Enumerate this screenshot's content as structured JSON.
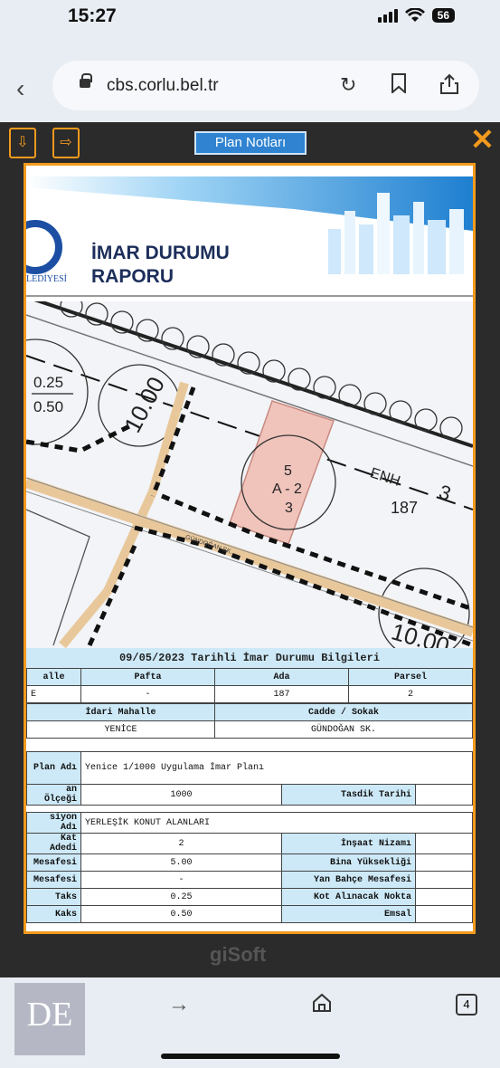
{
  "status": {
    "time": "15:27",
    "battery": "56"
  },
  "browser": {
    "url": "cbs.corlu.bel.tr"
  },
  "viewer": {
    "plan_button": "Plan Notları",
    "close": "✕",
    "footer_brand": "giSoft"
  },
  "report": {
    "logo_text": "LEDİYESİ",
    "title_line1": "İMAR DURUMU",
    "title_line2": "RAPORU"
  },
  "map": {
    "ratio_top": "0.25",
    "ratio_bottom": "0.50",
    "road_width_left": "10.00",
    "parcel_top": "5",
    "parcel_mid": "A - 2",
    "parcel_bottom": "3",
    "road_code": "ENH",
    "road_num": "3",
    "block_no": "187",
    "street_label": "GÜNDOĞAN SK.",
    "road_width_right": "10.00"
  },
  "info": {
    "title": "09/05/2023 Tarihli İmar Durumu Bilgileri",
    "head1": [
      "alle",
      "Pafta",
      "Ada",
      "Parsel"
    ],
    "row1": [
      "E",
      "-",
      "187",
      "2"
    ],
    "head2": [
      "İdari Mahalle",
      "Cadde / Sokak"
    ],
    "row2": [
      "YENİCE",
      "GÜNDOĞAN SK."
    ],
    "plan_label": "Plan Adı",
    "plan_value": "Yenice 1/1000 Uygulama İmar Planı",
    "scale_label": "an Ölçeği",
    "scale_value": "1000",
    "approval_label": "Tasdik Tarihi",
    "approval_value": "",
    "function_label": "siyon Adı",
    "function_value": "YERLEŞİK KONUT ALANLARI",
    "rows": [
      {
        "l": "Kat Adedi",
        "v": "2",
        "l2": "İnşaat Nizamı",
        "v2": ""
      },
      {
        "l": "Mesafesi",
        "v": "5.00",
        "l2": "Bina Yüksekliği",
        "v2": ""
      },
      {
        "l": "Mesafesi",
        "v": "-",
        "l2": "Yan Bahçe Mesafesi",
        "v2": ""
      },
      {
        "l": "Taks",
        "v": "0.25",
        "l2": "Kot Alınacak Nokta",
        "v2": ""
      },
      {
        "l": "Kaks",
        "v": "0.50",
        "l2": "Emsal",
        "v2": ""
      }
    ]
  },
  "bottom": {
    "tab_count": "4",
    "watermark": "DE"
  }
}
